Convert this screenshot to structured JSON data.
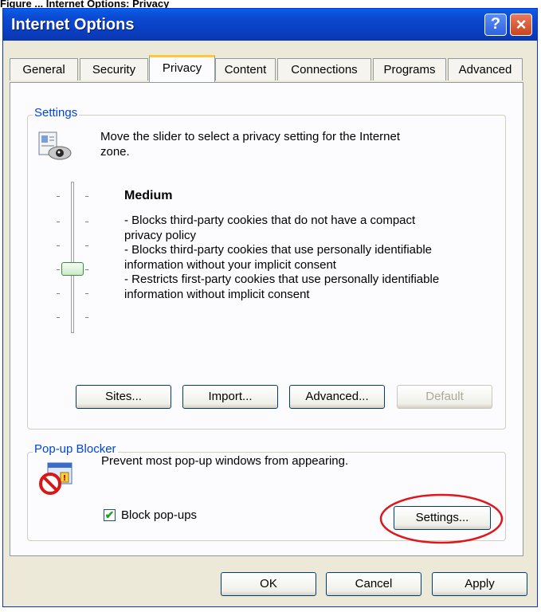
{
  "caption": "Figure ... Internet Options: Privacy",
  "window": {
    "title": "Internet Options",
    "help_icon": "?",
    "close_icon": "×"
  },
  "tabs": [
    "General",
    "Security",
    "Privacy",
    "Content",
    "Connections",
    "Programs",
    "Advanced"
  ],
  "active_tab": "Privacy",
  "settings": {
    "group_label": "Settings",
    "intro": [
      "Move the slider to select a privacy setting for the Internet",
      "zone."
    ],
    "level": "Medium",
    "description": [
      "- Blocks third-party cookies that do not have a compact",
      "privacy policy",
      "- Blocks third-party cookies that use personally identifiable",
      "information without your implicit consent",
      "- Restricts first-party cookies that use personally identifiable",
      "information without implicit consent"
    ],
    "slider_level": "3 of 6 (Medium)",
    "buttons": {
      "sites": "Sites...",
      "import": "Import...",
      "advanced": "Advanced...",
      "default": "Default"
    }
  },
  "popup": {
    "group_label": "Pop-up Blocker",
    "description": "Prevent most pop-up windows from appearing.",
    "checkbox_label": "Block pop-ups",
    "checkbox_checked": true,
    "settings_button": "Settings..."
  },
  "footer": {
    "ok": "OK",
    "cancel": "Cancel",
    "apply": "Apply"
  },
  "colors": {
    "highlight": "#e0161b",
    "titlebar": "#0a4cd0"
  }
}
